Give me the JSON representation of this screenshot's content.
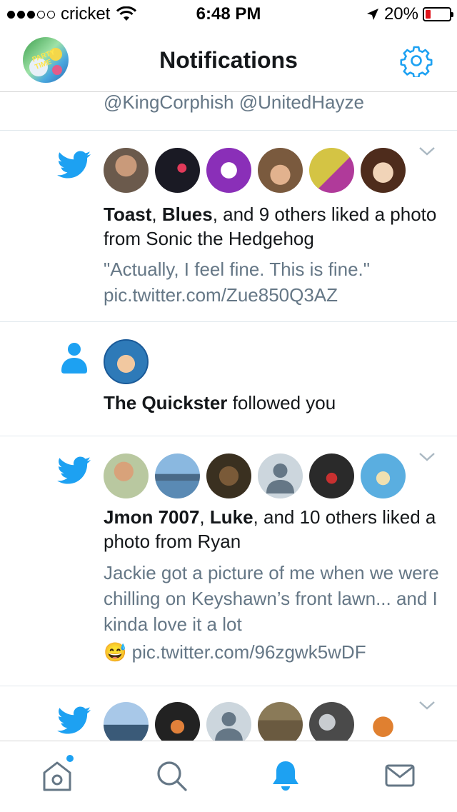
{
  "status_bar": {
    "carrier": "cricket",
    "time": "6:48 PM",
    "battery": "20%",
    "signal_bars_filled": 3,
    "signal_bars_total": 5
  },
  "header": {
    "title": "Notifications",
    "settings_icon": "gear-icon",
    "avatar_art_text": "PARTY TIME"
  },
  "notifications": [
    {
      "type": "mentions-fragment",
      "text": "@KingCorphish @UnitedHayze"
    },
    {
      "type": "like",
      "icon": "twitter-bird-icon",
      "user1": "Toast",
      "sep1": ", ",
      "user2": "Blues",
      "rest": ", and 9 others liked a photo from Sonic the Hedgehog",
      "tweet": "\"Actually, I feel fine. This is fine.\" pic.twitter.com/Zue850Q3AZ",
      "avatars": [
        "#6b5a4c",
        "#1a1a24",
        "#8a2fb8",
        "#7a5a3e",
        "#d4c444",
        "#4e2c1c"
      ]
    },
    {
      "type": "follow",
      "icon": "person-icon",
      "user": "The Quickster",
      "rest": " followed you",
      "avatars": [
        "#2e7ab8"
      ]
    },
    {
      "type": "like",
      "icon": "twitter-bird-icon",
      "user1": "Jmon 7007",
      "sep1": ", ",
      "user2": "Luke",
      "rest": ", and 10 others liked a photo from Ryan",
      "tweet": "Jackie got a picture of me when we were chilling on Keyshawn’s front lawn... and I kinda love it a lot",
      "tweet_link": "pic.twitter.com/96zgwk5wDF",
      "emoji": "😅",
      "avatars": [
        "#b9c8a0",
        "#5a8ab4",
        "#3a3020",
        "#ccd6dd",
        "#2a2a2a",
        "#5aaee0"
      ]
    },
    {
      "type": "like-partial",
      "icon": "twitter-bird-icon",
      "avatars": [
        "#6a9ac8",
        "#222222",
        "#ccd6dd",
        "#6a5a40",
        "#4a4a4a",
        "#ffffff"
      ]
    }
  ],
  "tabbar": {
    "items": [
      "home-icon",
      "search-icon",
      "notifications-bell-icon",
      "messages-icon"
    ],
    "active": "notifications-bell-icon",
    "accent": "#1da1f2",
    "inactive": "#657786"
  },
  "colors": {
    "accent": "#1da1f2",
    "text": "#14171a",
    "secondary_text": "#657786",
    "divider": "#e1e8ed",
    "battery_low": "#e0141b"
  }
}
